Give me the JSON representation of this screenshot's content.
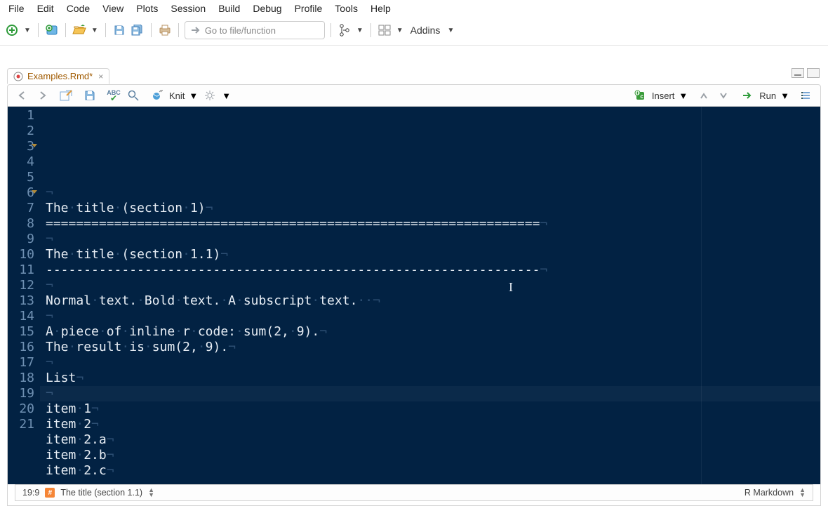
{
  "menu": {
    "items": [
      "File",
      "Edit",
      "Code",
      "View",
      "Plots",
      "Session",
      "Build",
      "Debug",
      "Profile",
      "Tools",
      "Help"
    ]
  },
  "toolbar": {
    "goto_placeholder": "Go to file/function",
    "addins_label": "Addins"
  },
  "tab": {
    "filename": "Examples.Rmd*"
  },
  "editorToolbar": {
    "knit_label": "Knit",
    "insert_label": "Insert",
    "run_label": "Run",
    "abc_label": "ABC"
  },
  "editor": {
    "gutter_start": 1,
    "gutter_end": 21,
    "fold_lines": [
      3,
      6
    ],
    "active_line_index": 18,
    "lines": [
      "",
      "The title (section 1)",
      "=================================================================",
      "",
      "The title (section 1.1)",
      "-----------------------------------------------------------------",
      "",
      "Normal text. Bold text. A subscript text.  ",
      "",
      "A piece of inline r code: sum(2, 9).",
      "The result is sum(2, 9).",
      "",
      "List",
      "",
      "item 1",
      "item 2",
      "item 2.a",
      "item 2.b",
      "item 2.c",
      "",
      ""
    ]
  },
  "status": {
    "cursor": "19:9",
    "outline_label": "The title (section 1.1)",
    "mode_label": "R Markdown"
  }
}
